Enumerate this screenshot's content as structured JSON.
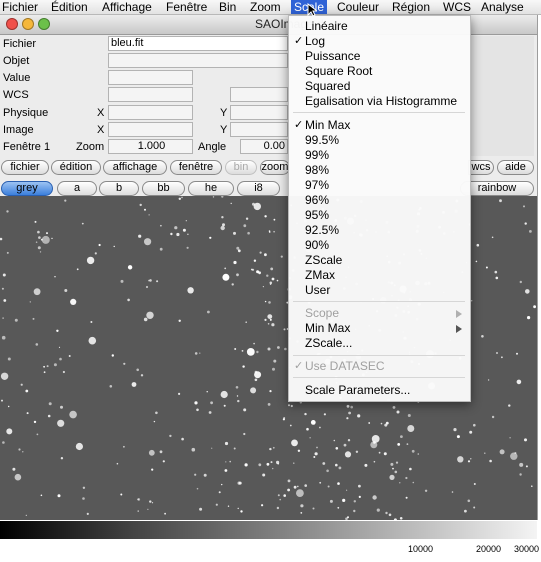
{
  "menubar": {
    "items": [
      {
        "label": "Fichier"
      },
      {
        "label": "Édition"
      },
      {
        "label": "Affichage"
      },
      {
        "label": "Fenêtre"
      },
      {
        "label": "Bin"
      },
      {
        "label": "Zoom"
      },
      {
        "label": "Scale"
      },
      {
        "label": "Couleur"
      },
      {
        "label": "Région"
      },
      {
        "label": "WCS"
      },
      {
        "label": "Analyse"
      }
    ]
  },
  "window": {
    "title": "SAOImage d",
    "colors": {
      "close": "#f0504a",
      "minimize": "#f5b73a",
      "zoom": "#6cc04a"
    }
  },
  "info_panel": {
    "labels": {
      "fichier": "Fichier",
      "objet": "Objet",
      "value": "Value",
      "wcs": "WCS",
      "physique": "Physique",
      "image": "Image",
      "fenetre": "Fenêtre 1",
      "x1": "X",
      "x2": "X",
      "y1": "Y",
      "y2": "Y",
      "zoom": "Zoom",
      "angle": "Angle"
    },
    "values": {
      "fichier": "bleu.fit",
      "zoom": "1.000",
      "angle": "0.00"
    }
  },
  "button_row1": [
    "fichier",
    "édition",
    "affichage",
    "fenêtre",
    "bin",
    "zoom",
    "wcs",
    "aide"
  ],
  "button_row2": [
    "grey",
    "a",
    "b",
    "bb",
    "he",
    "i8",
    "rainbow"
  ],
  "colorbar": {
    "ticks": [
      "10000",
      "20000",
      "30000"
    ]
  },
  "scale_menu": {
    "group1": [
      "Linéaire",
      "Log",
      "Puissance",
      "Square Root",
      "Squared",
      "Egalisation via Histogramme"
    ],
    "group2": [
      "Min Max",
      "99.5%",
      "99%",
      "98%",
      "97%",
      "96%",
      "95%",
      "92.5%",
      "90%",
      "ZScale",
      "ZMax",
      "User"
    ],
    "group3": [
      "Scope",
      "Min Max",
      "ZScale..."
    ],
    "group4": [
      "Use DATASEC"
    ],
    "group5": [
      "Scale Parameters..."
    ],
    "check_glyph": "✓"
  }
}
